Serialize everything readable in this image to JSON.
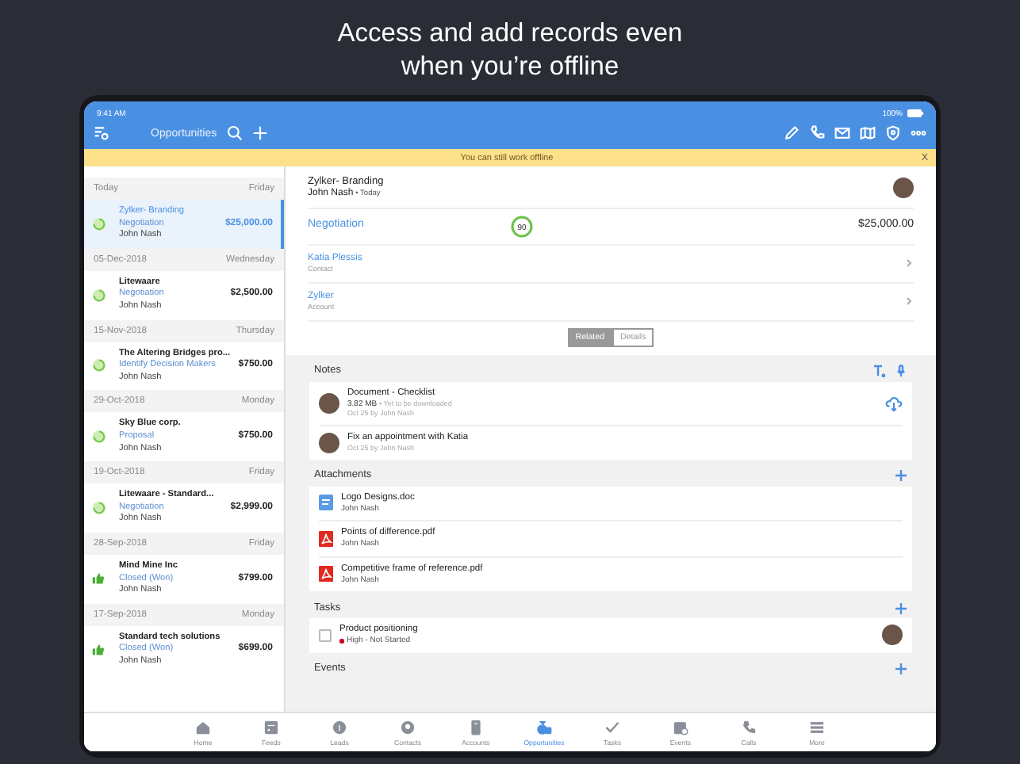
{
  "headline": "Access and add records even when you’re offline",
  "status_bar": {
    "time": "9:41 AM",
    "battery": "100%"
  },
  "nav": {
    "title": "Opportunities"
  },
  "banner": {
    "text": "You can still work offline",
    "close": "X"
  },
  "list": [
    {
      "date": "Today",
      "day": "Friday",
      "items": [
        {
          "name": "Zylker-  Branding",
          "stage": "Negotiation",
          "owner": "John Nash",
          "amount": "$25,000.00",
          "kind": "stage",
          "selected": true
        }
      ]
    },
    {
      "date": "05-Dec-2018",
      "day": "Wednesday",
      "items": [
        {
          "name": "Litewaare",
          "stage": "Negotiation",
          "owner": "John Nash",
          "amount": "$2,500.00",
          "kind": "stage",
          "selected": false
        }
      ]
    },
    {
      "date": "15-Nov-2018",
      "day": "Thursday",
      "items": [
        {
          "name": "The Altering Bridges pro...",
          "stage": "Identify Decision Makers",
          "owner": "John Nash",
          "amount": "$750.00",
          "kind": "stage",
          "selected": false
        }
      ]
    },
    {
      "date": "29-Oct-2018",
      "day": "Monday",
      "items": [
        {
          "name": "Sky Blue corp.",
          "stage": "Proposal",
          "owner": "John Nash",
          "amount": "$750.00",
          "kind": "stage",
          "selected": false
        }
      ]
    },
    {
      "date": "19-Oct-2018",
      "day": "Friday",
      "items": [
        {
          "name": "Litewaare - Standard...",
          "stage": "Negotiation",
          "owner": "John Nash",
          "amount": "$2,999.00",
          "kind": "stage",
          "selected": false
        }
      ]
    },
    {
      "date": "28-Sep-2018",
      "day": "Friday",
      "items": [
        {
          "name": "Mind Mine Inc",
          "stage": "Closed (Won)",
          "owner": "John Nash",
          "amount": "$799.00",
          "kind": "won",
          "selected": false
        }
      ]
    },
    {
      "date": "17-Sep-2018",
      "day": "Monday",
      "items": [
        {
          "name": "Standard tech solutions",
          "stage": "Closed (Won)",
          "owner": "John Nash",
          "amount": "$699.00",
          "kind": "won",
          "selected": false
        }
      ]
    }
  ],
  "detail": {
    "title": "Zylker-  Branding",
    "owner": "John Nash",
    "when": "• Today",
    "stage": "Negotiation",
    "probability": "90",
    "amount": "$25,000.00",
    "links": [
      {
        "name": "Katia Plessis",
        "type": "Contact"
      },
      {
        "name": "Zylker",
        "type": "Account"
      }
    ],
    "segments": [
      {
        "label": "Related",
        "selected": true
      },
      {
        "label": "Details",
        "selected": false
      }
    ],
    "notes": {
      "title": "Notes",
      "items": [
        {
          "title": "Document - Checklist",
          "size": "3.82 MB",
          "status": "• Yet to be downloaded",
          "meta": "Oct 25 by John Nash",
          "downloaded": false
        },
        {
          "title": "Fix an appointment with Katia",
          "meta": "Oct 25 by John Nash",
          "downloaded": true
        }
      ]
    },
    "attachments": {
      "title": "Attachments",
      "items": [
        {
          "name": "Logo Designs.doc",
          "owner": "John Nash",
          "kind": "doc"
        },
        {
          "name": "Points of difference.pdf",
          "owner": "John Nash",
          "kind": "pdf"
        },
        {
          "name": "Competitive frame of reference.pdf",
          "owner": "John Nash",
          "kind": "pdf"
        }
      ]
    },
    "tasks": {
      "title": "Tasks",
      "items": [
        {
          "title": "Product positioning",
          "priority": "High - Not Started",
          "color": "#d0021b",
          "checked": false
        }
      ]
    },
    "events": {
      "title": "Events"
    }
  },
  "tabs": [
    {
      "label": "Home",
      "selected": false
    },
    {
      "label": "Feeds",
      "selected": false
    },
    {
      "label": "Leads",
      "selected": false
    },
    {
      "label": "Contacts",
      "selected": false
    },
    {
      "label": "Accounts",
      "selected": false
    },
    {
      "label": "Opportunities",
      "selected": true
    },
    {
      "label": "Tasks",
      "selected": false
    },
    {
      "label": "Events",
      "selected": false
    },
    {
      "label": "Calls",
      "selected": false
    },
    {
      "label": "More",
      "selected": false
    }
  ]
}
